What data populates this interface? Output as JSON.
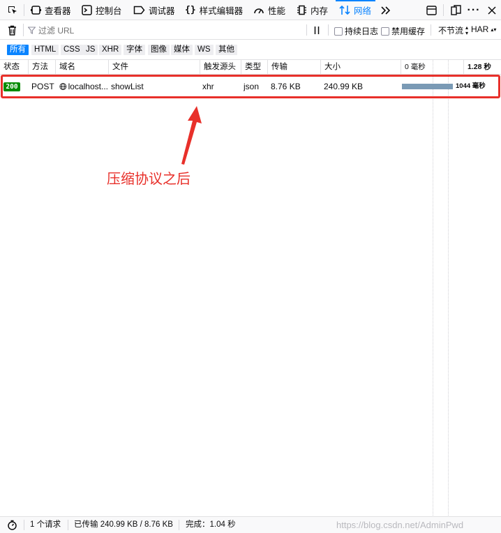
{
  "toolbar": {
    "tabs": [
      {
        "label": "查看器",
        "icon": "inspector-icon"
      },
      {
        "label": "控制台",
        "icon": "console-icon"
      },
      {
        "label": "调试器",
        "icon": "debugger-icon"
      },
      {
        "label": "样式编辑器",
        "icon": "style-editor-icon"
      },
      {
        "label": "性能",
        "icon": "performance-icon"
      },
      {
        "label": "内存",
        "icon": "memory-icon"
      },
      {
        "label": "网络",
        "icon": "network-icon",
        "active": true
      }
    ],
    "accent_color": "#0a84ff"
  },
  "filter": {
    "placeholder": "过滤 URL",
    "persist_logs_label": "持续日志",
    "disable_cache_label": "禁用缓存",
    "throttle_label": "不节流",
    "har_label": "HAR"
  },
  "type_filters": [
    "所有",
    "HTML",
    "CSS",
    "JS",
    "XHR",
    "字体",
    "图像",
    "媒体",
    "WS",
    "其他"
  ],
  "columns": {
    "status": "状态",
    "method": "方法",
    "domain": "域名",
    "file": "文件",
    "cause": "触发源头",
    "type": "类型",
    "transferred": "传输",
    "size": "大小",
    "waterfall_start": "0 毫秒",
    "waterfall_end": "1.28 秒"
  },
  "requests": [
    {
      "status": "200",
      "method": "POST",
      "domain": "localhost...",
      "file": "showList",
      "cause": "xhr",
      "type": "json",
      "transferred": "8.76 KB",
      "size": "240.99 KB",
      "waterfall_label": "1044 毫秒",
      "status_color": "#058b00"
    }
  ],
  "annotation": {
    "text": "压缩协议之后",
    "color": "#e8302a"
  },
  "statusbar": {
    "requests": "1 个请求",
    "transferred": "已传输 240.99 KB / 8.76 KB",
    "finish": "完成：1.04 秒",
    "watermark": "https://blog.csdn.net/AdminPwd"
  }
}
